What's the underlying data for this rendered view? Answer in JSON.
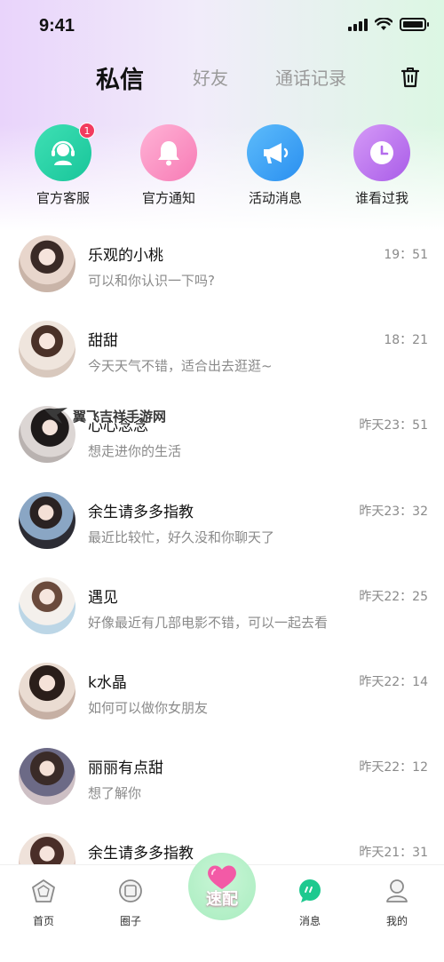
{
  "status_bar": {
    "time": "9:41"
  },
  "tabs": [
    {
      "label": "私信",
      "active": true
    },
    {
      "label": "好友",
      "active": false
    },
    {
      "label": "通话记录",
      "active": false
    }
  ],
  "shortcuts": [
    {
      "label": "官方客服",
      "icon": "customer-service-icon",
      "color": "#2bd3a8",
      "badge": "1"
    },
    {
      "label": "官方通知",
      "icon": "bell-icon",
      "color": "#fb8fc0",
      "badge": ""
    },
    {
      "label": "活动消息",
      "icon": "megaphone-icon",
      "color": "#3ea6f5",
      "badge": ""
    },
    {
      "label": "谁看过我",
      "icon": "clock-icon",
      "color": "#c079f0",
      "badge": ""
    }
  ],
  "conversations": [
    {
      "name": "乐观的小桃",
      "message": "可以和你认识一下吗?",
      "time": "19：51"
    },
    {
      "name": "甜甜",
      "message": "今天天气不错，适合出去逛逛~",
      "time": "18：21"
    },
    {
      "name": "心心念念",
      "message": "想走进你的生活",
      "time": "昨天23：51"
    },
    {
      "name": "余生请多多指教",
      "message": "最近比较忙，好久没和你聊天了",
      "time": "昨天23：32"
    },
    {
      "name": "遇见",
      "message": "好像最近有几部电影不错，可以一起去看",
      "time": "昨天22：25"
    },
    {
      "name": "k水晶",
      "message": "如何可以做你女朋友",
      "time": "昨天22：14"
    },
    {
      "name": "丽丽有点甜",
      "message": "想了解你",
      "time": "昨天22：12"
    },
    {
      "name": "余生请多多指教",
      "message": "",
      "time": "昨天21：31"
    }
  ],
  "watermark": "翼飞吉祥手游网",
  "bottom_nav": {
    "home": "首页",
    "circle": "圈子",
    "match": "速配",
    "messages": "消息",
    "me": "我的"
  },
  "colors": {
    "accent_green": "#2bd3a8",
    "badge_red": "#f23b5e",
    "match_pink": "#f35aa6"
  }
}
